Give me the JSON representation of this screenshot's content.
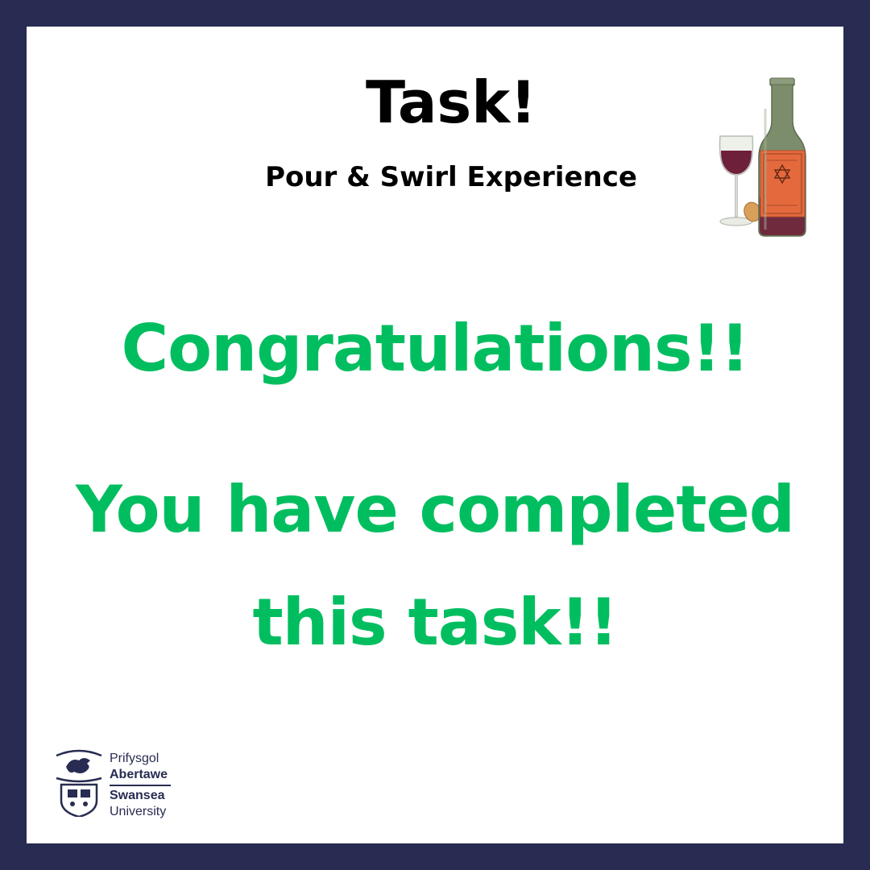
{
  "header": {
    "title": "Task!",
    "subtitle": "Pour & Swirl Experience"
  },
  "message": {
    "congratulations": "Congratulations!!",
    "completed_line1": "You have completed",
    "completed_line2": "this task!!"
  },
  "logo": {
    "welsh_line1": "Prifysgol",
    "welsh_line2": "Abertawe",
    "english_line1": "Swansea",
    "english_line2": "University"
  },
  "illustration": {
    "icon": "wine-bottle-and-glass"
  },
  "colors": {
    "border": "#282c52",
    "background": "#ffffff",
    "accent_green": "#00be5f",
    "heading_text": "#000000"
  }
}
